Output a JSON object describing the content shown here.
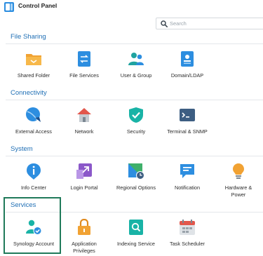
{
  "window": {
    "title": "Control Panel"
  },
  "search": {
    "placeholder": "Search",
    "value": ""
  },
  "sections": {
    "file_sharing": {
      "title": "File Sharing",
      "items": [
        "Shared Folder",
        "File Services",
        "User & Group",
        "Domain/LDAP"
      ]
    },
    "connectivity": {
      "title": "Connectivity",
      "items": [
        "External Access",
        "Network",
        "Security",
        "Terminal & SNMP"
      ]
    },
    "system": {
      "title": "System",
      "items": [
        "Info Center",
        "Login Portal",
        "Regional Options",
        "Notification",
        "Hardware &",
        "Power"
      ]
    },
    "services": {
      "title": "Services",
      "items": [
        "Synology Account",
        "Application",
        "Privileges",
        "Indexing Service",
        "Task Scheduler"
      ]
    }
  },
  "colors": {
    "section_title": "#1f6fb5",
    "highlight_border": "#1f7a5a"
  }
}
